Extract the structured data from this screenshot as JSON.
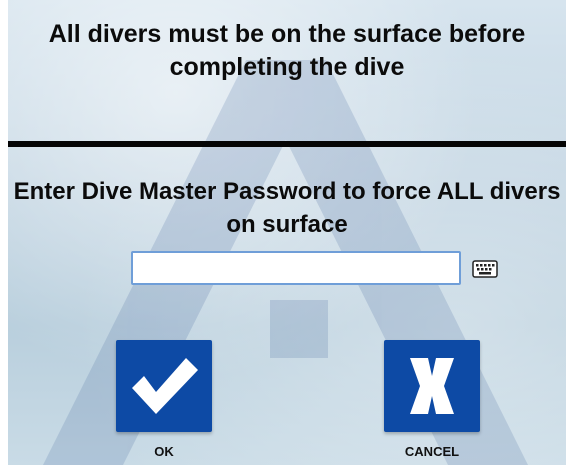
{
  "dialog": {
    "message": "All divers must be on the surface before completing the dive",
    "prompt": "Enter Dive Master Password to force ALL divers on surface"
  },
  "password_field": {
    "value": "",
    "placeholder": ""
  },
  "buttons": {
    "ok": {
      "label": "OK",
      "icon": "checkmark-icon"
    },
    "cancel": {
      "label": "CANCEL",
      "icon": "x-icon"
    }
  },
  "icons": {
    "keyboard": "keyboard-icon"
  },
  "colors": {
    "button_bg": "#0d4aa5",
    "field_border": "#6f9ed8",
    "divider": "#050505"
  }
}
